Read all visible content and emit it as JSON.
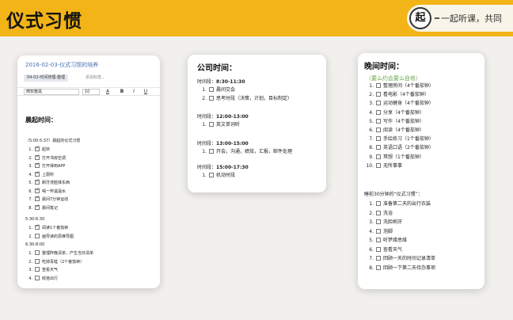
{
  "header": {
    "title": "仪式习惯",
    "brand_logo": "起",
    "brand_text": "一起听课，共同"
  },
  "card1": {
    "doc_title": "2016-02-03-仪式习惯的培养",
    "tag": "04-02-时间管理-整理",
    "tag_add": "添加标签...",
    "font_name": "微软雅黑",
    "font_size": "10",
    "tool_color": "A",
    "tool_bold": "B",
    "tool_italic": "I",
    "tool_underline": "U",
    "heading": "晨起时间：",
    "sub_morning": "（5:00-5:37）晨起的仪式习惯",
    "morning_items": [
      {
        "num": "1.",
        "text": "起床",
        "checked": true
      },
      {
        "num": "2.",
        "text": "打开书房空调",
        "checked": true
      },
      {
        "num": "3.",
        "text": "打开得到APP",
        "checked": true
      },
      {
        "num": "4.",
        "text": "上厕所",
        "checked": true
      },
      {
        "num": "5.",
        "text": "刷牙洗脸抹东西",
        "checked": true
      },
      {
        "num": "6.",
        "text": "喝一杯温温水",
        "checked": true
      },
      {
        "num": "7.",
        "text": "晨间7分钟运动",
        "checked": true
      },
      {
        "num": "8.",
        "text": "晨间笔记",
        "checked": true
      }
    ],
    "sub_mid": "5:30-6:30",
    "mid_items": [
      {
        "num": "1.",
        "text": "阅读1个番茄钟",
        "checked": true
      },
      {
        "num": "2.",
        "text": "画导读的思维导图",
        "checked": false
      }
    ],
    "sub_late": "6:30-8:00",
    "late_items": [
      {
        "num": "1.",
        "text": "整理昨晚清单，产生当日清单",
        "checked": false
      },
      {
        "num": "2.",
        "text": "吃掉青蛙（2个番茄钟）",
        "checked": false
      },
      {
        "num": "3.",
        "text": "查看天气",
        "checked": false
      },
      {
        "num": "4.",
        "text": "收拾出行",
        "checked": false
      }
    ]
  },
  "card2": {
    "title": "公司时间：",
    "blocks": [
      {
        "label": "时间段：",
        "time": "8:30-11:30",
        "items": [
          {
            "num": "1.",
            "text": "晨间交会"
          },
          {
            "num": "2.",
            "text": "思考时段（决策，计划，目标制定）"
          }
        ]
      },
      {
        "label": "时间段：",
        "time": "12:00-13:00",
        "items": [
          {
            "num": "1.",
            "text": "英文单词听"
          }
        ]
      },
      {
        "label": "时间段：",
        "time": "13:00-15:00",
        "items": [
          {
            "num": "1.",
            "text": "开会，沟通，绩效，汇报，邮件处理"
          }
        ]
      },
      {
        "label": "时间段：",
        "time": "15:00-17:30",
        "items": [
          {
            "num": "1.",
            "text": "机动时段"
          }
        ]
      }
    ]
  },
  "card3": {
    "title": "晚间时间：",
    "subtitle": "（要么约会要么自修）",
    "evening_items": [
      {
        "num": "1.",
        "text": "整理房间（4个番茄钟）"
      },
      {
        "num": "2.",
        "text": "看电影（4个番茄钟）"
      },
      {
        "num": "3.",
        "text": "运动健身（4个番茄钟）"
      },
      {
        "num": "4.",
        "text": "分享（4个番茄钟）"
      },
      {
        "num": "5.",
        "text": "写作（4个番茄钟）"
      },
      {
        "num": "6.",
        "text": "阅读（4个番茄钟）"
      },
      {
        "num": "7.",
        "text": "手绘练习（1个番茄钟）"
      },
      {
        "num": "8.",
        "text": "英语口语（2个番茄钟）"
      },
      {
        "num": "9.",
        "text": "冥想（1个番茄钟）"
      },
      {
        "num": "10.",
        "text": "无所事事"
      }
    ],
    "bedtime_title": "睡前30分钟的“仪式习惯”：",
    "bedtime_items": [
      {
        "num": "1.",
        "text": "准备第二天的出行衣装"
      },
      {
        "num": "2.",
        "text": "洗浴"
      },
      {
        "num": "3.",
        "text": "洗脸刷牙"
      },
      {
        "num": "4.",
        "text": "泡脚"
      },
      {
        "num": "5.",
        "text": "听梦缘思维"
      },
      {
        "num": "6.",
        "text": "查看天气"
      },
      {
        "num": "7.",
        "text": "回顾一天的时间记录清单"
      },
      {
        "num": "8.",
        "text": "回顾一下第二天待办事项"
      }
    ]
  }
}
